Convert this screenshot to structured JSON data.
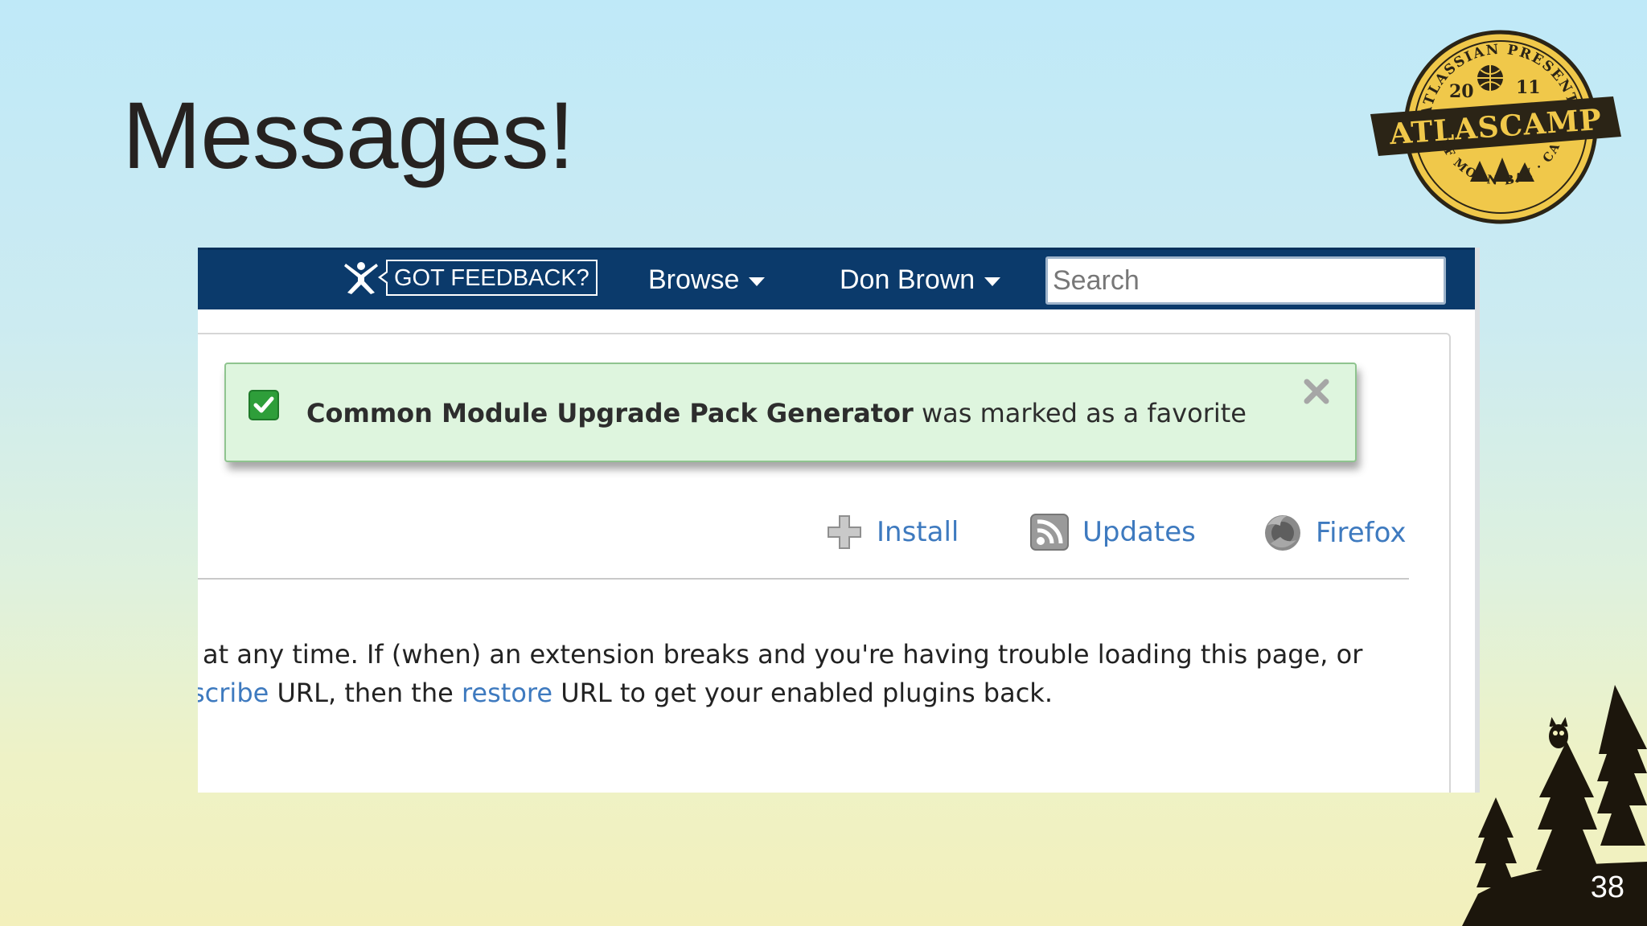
{
  "slide": {
    "title": "Messages!",
    "page_number": "38"
  },
  "badge": {
    "top_text": "ATLASSIAN PRESENTS",
    "year_left": "20",
    "year_right": "11",
    "name": "ATLASCAMP",
    "bottom_text": "HALF MOON BAY · CALIF"
  },
  "topbar": {
    "feedback_label": "GOT FEEDBACK?",
    "browse_label": "Browse",
    "user_label": "Don Brown",
    "search_placeholder": "Search"
  },
  "message": {
    "subject": "Common Module Upgrade Pack Generator",
    "text": "was marked as a favorite"
  },
  "toolbar": {
    "install_label": "Install",
    "updates_label": "Updates",
    "firefox_label": "Firefox"
  },
  "body": {
    "line1": "at any time. If (when) an extension breaks and you're having trouble loading this page, or",
    "line2_link1": "scribe",
    "line2_text1": " URL, then the ",
    "line2_link2": "restore",
    "line2_text2": " URL to get your enabled plugins back."
  },
  "colors": {
    "topbar": "#0b3a6b",
    "message_bg": "#def5de",
    "message_border": "#8fc48f",
    "link": "#3e7abf",
    "check": "#2e9e3a"
  }
}
